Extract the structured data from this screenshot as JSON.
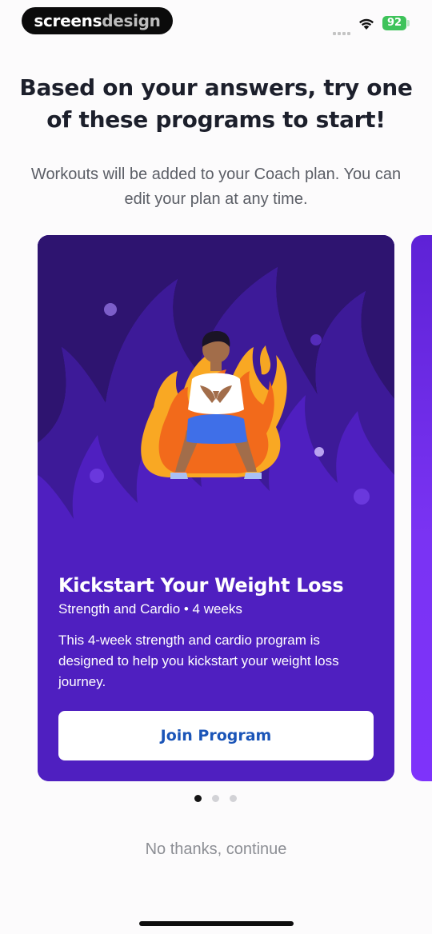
{
  "status_bar": {
    "brand_part1": "screens",
    "brand_part2": "design",
    "battery": "92",
    "icons": [
      "signal-icon",
      "wifi-icon",
      "battery-icon"
    ]
  },
  "header": {
    "title": "Based on your answers, try one of these programs to start!",
    "subtitle": "Workouts will be added to your Coach plan. You can edit your plan at any time."
  },
  "program_card": {
    "title": "Kickstart Your Weight Loss",
    "meta": "Strength and Cardio • 4 weeks",
    "description": "This 4-week strength and cardio program is designed to help you kickstart your weight loss journey.",
    "button_label": "Join Program",
    "colors": {
      "card_background": "#4f1fc0",
      "flame_dark": "#2e1470",
      "button_text": "#1b55b8"
    }
  },
  "pager": {
    "count": 3,
    "active_index": 0
  },
  "footer": {
    "skip_label": "No thanks, continue"
  }
}
